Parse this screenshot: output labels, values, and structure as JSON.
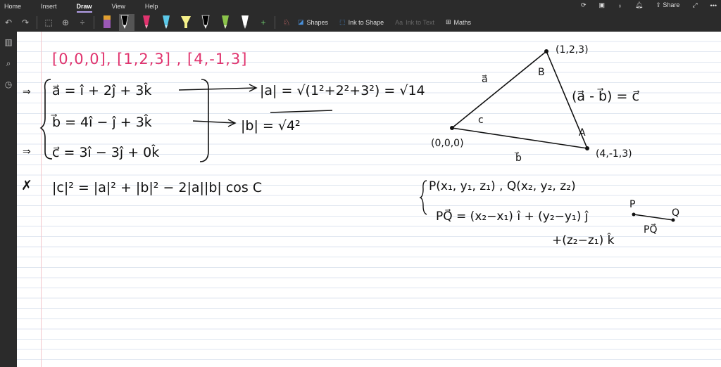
{
  "menu": {
    "tabs": [
      "Home",
      "Insert",
      "Draw",
      "View",
      "Help"
    ],
    "active": "Draw"
  },
  "top_right": {
    "share": "Share",
    "icons": [
      "sync-icon",
      "sticky-note-icon",
      "lightbulb-icon",
      "bell-icon",
      "share-icon",
      "expand-icon",
      "more-icon"
    ]
  },
  "toolbar": {
    "shapes": "Shapes",
    "ink_to_shape": "Ink to Shape",
    "ink_to_text": "Ink to Text",
    "maths": "Maths",
    "pens": [
      {
        "color": "#9b59b6"
      },
      {
        "color": "#000000"
      },
      {
        "color": "#e0336e"
      },
      {
        "color": "#5bc8e8"
      },
      {
        "color": "#f5f08a"
      },
      {
        "color": "#000000"
      },
      {
        "color": "#8bc34a"
      },
      {
        "color": "#ffffff"
      }
    ]
  },
  "ink": {
    "points_line": "[0,0,0],   [1,2,3] ,  [4,-1,3]",
    "eq_a": "a⃗ =  î + 2ĵ + 3k̂",
    "eq_b": "b⃗ =  4î − ĵ + 3k̂",
    "eq_c": "c⃗ =  3î − 3ĵ + 0k̂",
    "mag_a": "|a| = √(1²+2²+3²) = √14",
    "mag_b": "|b| = √4²",
    "arrow1": "⇒",
    "arrow2": "⇒",
    "star": "✗",
    "cosine": "|c|² = |a|² + |b|² −  2|a||b| cos C",
    "tri_b": "(1,2,3)",
    "tri_o": "(0,0,0)",
    "tri_c": "(4,-1,3)",
    "lbl_a": "a⃗",
    "lbl_b": "b⃗",
    "ang_B": "B",
    "ang_A": "A",
    "ang_C": "c",
    "a_minus_b": "(a⃗ - b⃗) = c⃗",
    "pq_points": "P(x₁, y₁, z₁)  ,  Q(x₂, y₂, z₂)",
    "pq_line1": "PQ⃗ = (x₂−x₁) î + (y₂−y₁) ĵ",
    "pq_line2": "+(z₂−z₁) k̂",
    "p": "P",
    "q": "Q",
    "pq": "PQ⃗"
  }
}
